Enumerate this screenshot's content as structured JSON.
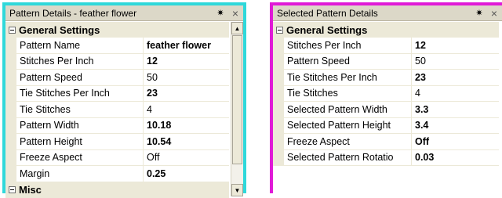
{
  "left_panel": {
    "title": "Pattern Details - feather flower",
    "pin_glyph": "✷",
    "close_glyph": "×",
    "sections": [
      {
        "label": "General Settings",
        "rows": [
          {
            "name": "Pattern Name",
            "value": "feather flower",
            "bold": true
          },
          {
            "name": "Stitches Per Inch",
            "value": "12",
            "bold": true
          },
          {
            "name": "Pattern Speed",
            "value": "50",
            "bold": false
          },
          {
            "name": "Tie Stitches Per Inch",
            "value": "23",
            "bold": true
          },
          {
            "name": "Tie Stitches",
            "value": "4",
            "bold": false
          },
          {
            "name": "Pattern Width",
            "value": "10.18",
            "bold": true
          },
          {
            "name": "Pattern Height",
            "value": "10.54",
            "bold": true
          },
          {
            "name": "Freeze Aspect",
            "value": "Off",
            "bold": false
          },
          {
            "name": "Margin",
            "value": "0.25",
            "bold": true
          }
        ]
      },
      {
        "label": "Misc",
        "rows": []
      }
    ]
  },
  "right_panel": {
    "title": "Selected Pattern Details",
    "pin_glyph": "✷",
    "close_glyph": "×",
    "sections": [
      {
        "label": "General Settings",
        "rows": [
          {
            "name": "Stitches Per Inch",
            "value": "12",
            "bold": true
          },
          {
            "name": "Pattern Speed",
            "value": "50",
            "bold": false
          },
          {
            "name": "Tie Stitches Per Inch",
            "value": "23",
            "bold": true
          },
          {
            "name": "Tie Stitches",
            "value": "4",
            "bold": false
          },
          {
            "name": "Selected Pattern Width",
            "value": "3.3",
            "bold": true
          },
          {
            "name": "Selected Pattern Height",
            "value": "3.4",
            "bold": true
          },
          {
            "name": "Freeze Aspect",
            "value": "Off",
            "bold": true
          },
          {
            "name": "Selected Pattern Rotatio",
            "value": "0.03",
            "bold": true
          }
        ]
      }
    ]
  },
  "colors": {
    "left_accent": "#2fd8da",
    "right_accent": "#e01ad7",
    "chrome": "#ece9d8"
  }
}
